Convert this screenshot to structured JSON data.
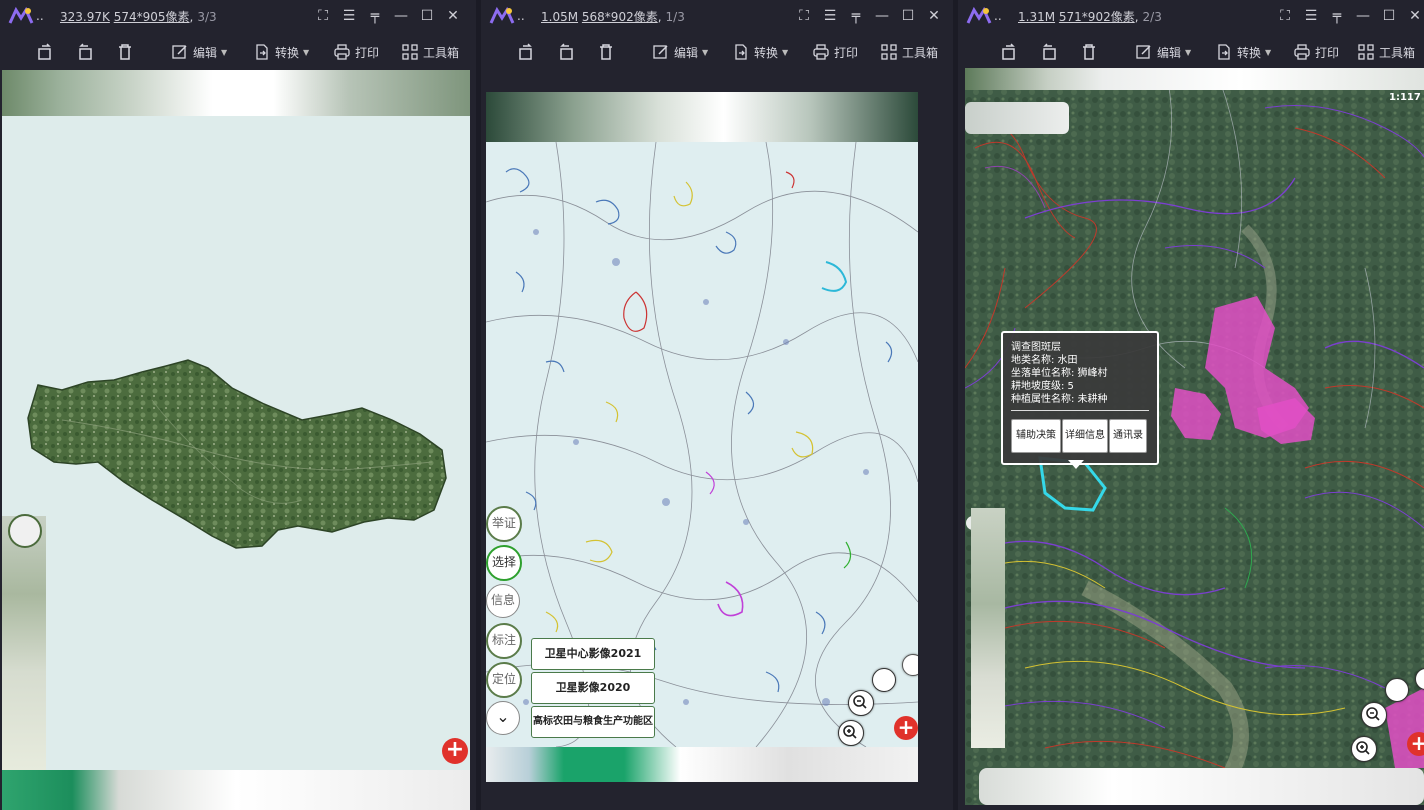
{
  "windows": [
    {
      "size": "323.97K",
      "dims": "574*905像素",
      "page": "3/3"
    },
    {
      "size": "1.05M",
      "dims": "568*902像素",
      "page": "1/3"
    },
    {
      "size": "1.31M",
      "dims": "571*902像素",
      "page": "2/3"
    }
  ],
  "app": {
    "dots": ".."
  },
  "toolbar": {
    "edit": "编辑",
    "convert": "转换",
    "print": "打印",
    "toolbox": "工具箱"
  },
  "side_buttons": [
    "举证",
    "选择",
    "信息",
    "标注",
    "定位"
  ],
  "layers": [
    "卫星中心影像2021",
    "卫星影像2020",
    "高标农田与粮食生产功能区"
  ],
  "popup": {
    "title": "调查图斑层",
    "lines": [
      "地类名称: 水田",
      "坐落单位名称: 狮峰村",
      "耕地坡度级: 5",
      "种植属性名称: 未耕种"
    ],
    "buttons": [
      "辅助决策",
      "详细信息",
      "通讯录"
    ]
  },
  "map3": {
    "scale_label": "1:117"
  },
  "colors": {
    "window_bg": "#23232e",
    "accent_green": "#1aa36a",
    "add_red": "#e0322b",
    "pink": "#e24fc6"
  }
}
